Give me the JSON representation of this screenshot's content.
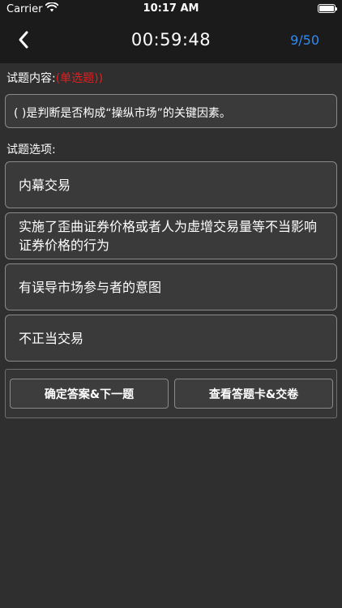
{
  "status_bar": {
    "carrier": "Carrier",
    "time": "10:17 AM",
    "icons": [
      "wifi-icon",
      "battery-icon"
    ]
  },
  "nav": {
    "back_icon": "chevron-left-icon",
    "timer": "00:59:48",
    "progress": "9/50"
  },
  "question": {
    "content_label": "试题内容:",
    "type": "(单选题))",
    "text": "( )是判断是否构成“操纵市场”的关键因素。",
    "options_label": "试题选项:",
    "options": [
      "内幕交易",
      "实施了歪曲证券价格或者人为虚增交易量等不当影响证券价格的行为",
      "有误导市场参与者的意图",
      "不正当交易"
    ]
  },
  "actions": {
    "confirm_next": "确定答案&下一题",
    "view_card_submit": "查看答题卡&交卷"
  },
  "colors": {
    "background": "#2f2f2f",
    "bar": "#1b1b1b",
    "accent": "#2f8cf0",
    "question_type": "#e02020"
  }
}
